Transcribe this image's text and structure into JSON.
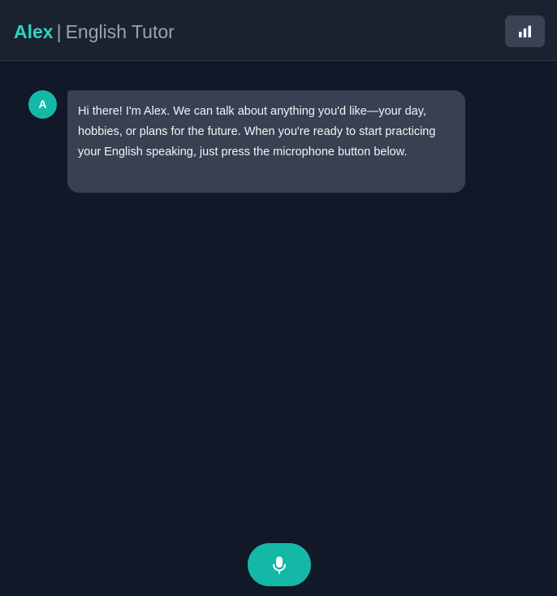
{
  "header": {
    "name": "Alex",
    "separator": "|",
    "subtitle": "English Tutor",
    "stats_icon": "bar-chart-icon"
  },
  "conversation": {
    "messages": [
      {
        "sender": "assistant",
        "avatar_initial": "A",
        "text": "Hi there! I'm Alex. We can talk about anything you'd like—your day, hobbies, or plans for the future. When you're ready to start practicing your English speaking, just press the microphone button below."
      }
    ]
  },
  "controls": {
    "mic_icon": "microphone-icon"
  },
  "colors": {
    "accent": "#14b8a6",
    "brand_text": "#2dd4bf",
    "background": "#111827",
    "header_background": "#1a2230",
    "bubble": "#374151"
  }
}
